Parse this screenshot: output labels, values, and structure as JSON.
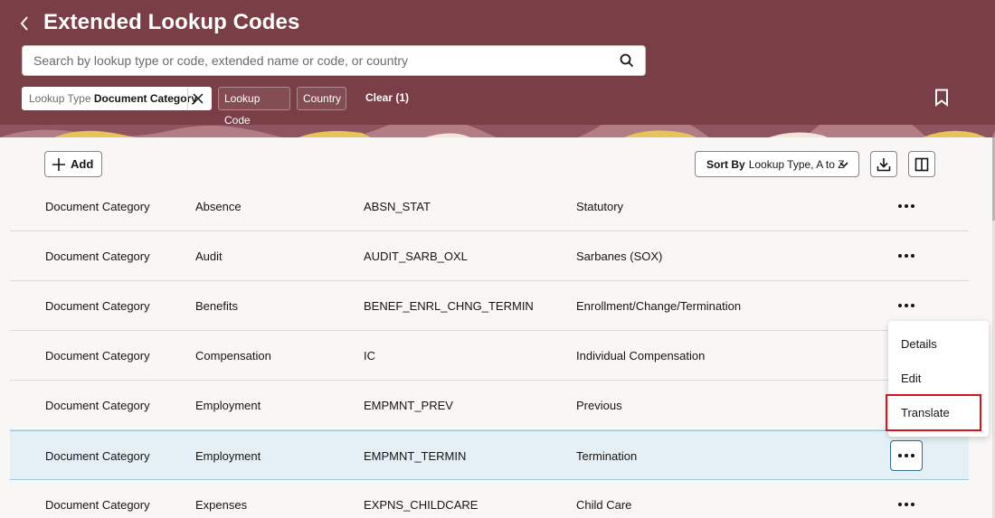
{
  "header": {
    "title": "Extended Lookup Codes",
    "back_icon": "chevron-left-icon",
    "search": {
      "placeholder": "Search by lookup type or code, extended name or code, or country",
      "value": "",
      "icon": "search-icon"
    },
    "filters": {
      "active_chip": {
        "label": "Lookup Type",
        "value": "Document Category"
      },
      "lookup_code_label": "Lookup Code",
      "country_label": "Country",
      "clear_label": "Clear (1)"
    },
    "bookmark_icon": "bookmark-icon",
    "colors": {
      "header_bg": "#7a3e46",
      "pattern_accent": "#e8c25a"
    }
  },
  "toolbar": {
    "add_label": "Add",
    "sort_label": "Sort By",
    "sort_value": "Lookup Type, A to Z",
    "download_icon": "download-icon",
    "columns_icon": "columns-icon"
  },
  "rows": [
    {
      "type": "Document Category",
      "category": "Absence",
      "code": "ABSN_STAT",
      "name": "Statutory"
    },
    {
      "type": "Document Category",
      "category": "Audit",
      "code": "AUDIT_SARB_OXL",
      "name": "Sarbanes (SOX)"
    },
    {
      "type": "Document Category",
      "category": "Benefits",
      "code": "BENEF_ENRL_CHNG_TERMIN",
      "name": "Enrollment/Change/Termination"
    },
    {
      "type": "Document Category",
      "category": "Compensation",
      "code": "IC",
      "name": "Individual Compensation"
    },
    {
      "type": "Document Category",
      "category": "Employment",
      "code": "EMPMNT_PREV",
      "name": "Previous"
    },
    {
      "type": "Document Category",
      "category": "Employment",
      "code": "EMPMNT_TERMIN",
      "name": "Termination"
    },
    {
      "type": "Document Category",
      "category": "Expenses",
      "code": "EXPNS_CHILDCARE",
      "name": "Child Care"
    }
  ],
  "selected_row": 5,
  "context_menu": {
    "items": [
      "Details",
      "Edit",
      "Translate"
    ],
    "highlighted": "Translate",
    "highlight_color": "#d7141d"
  }
}
